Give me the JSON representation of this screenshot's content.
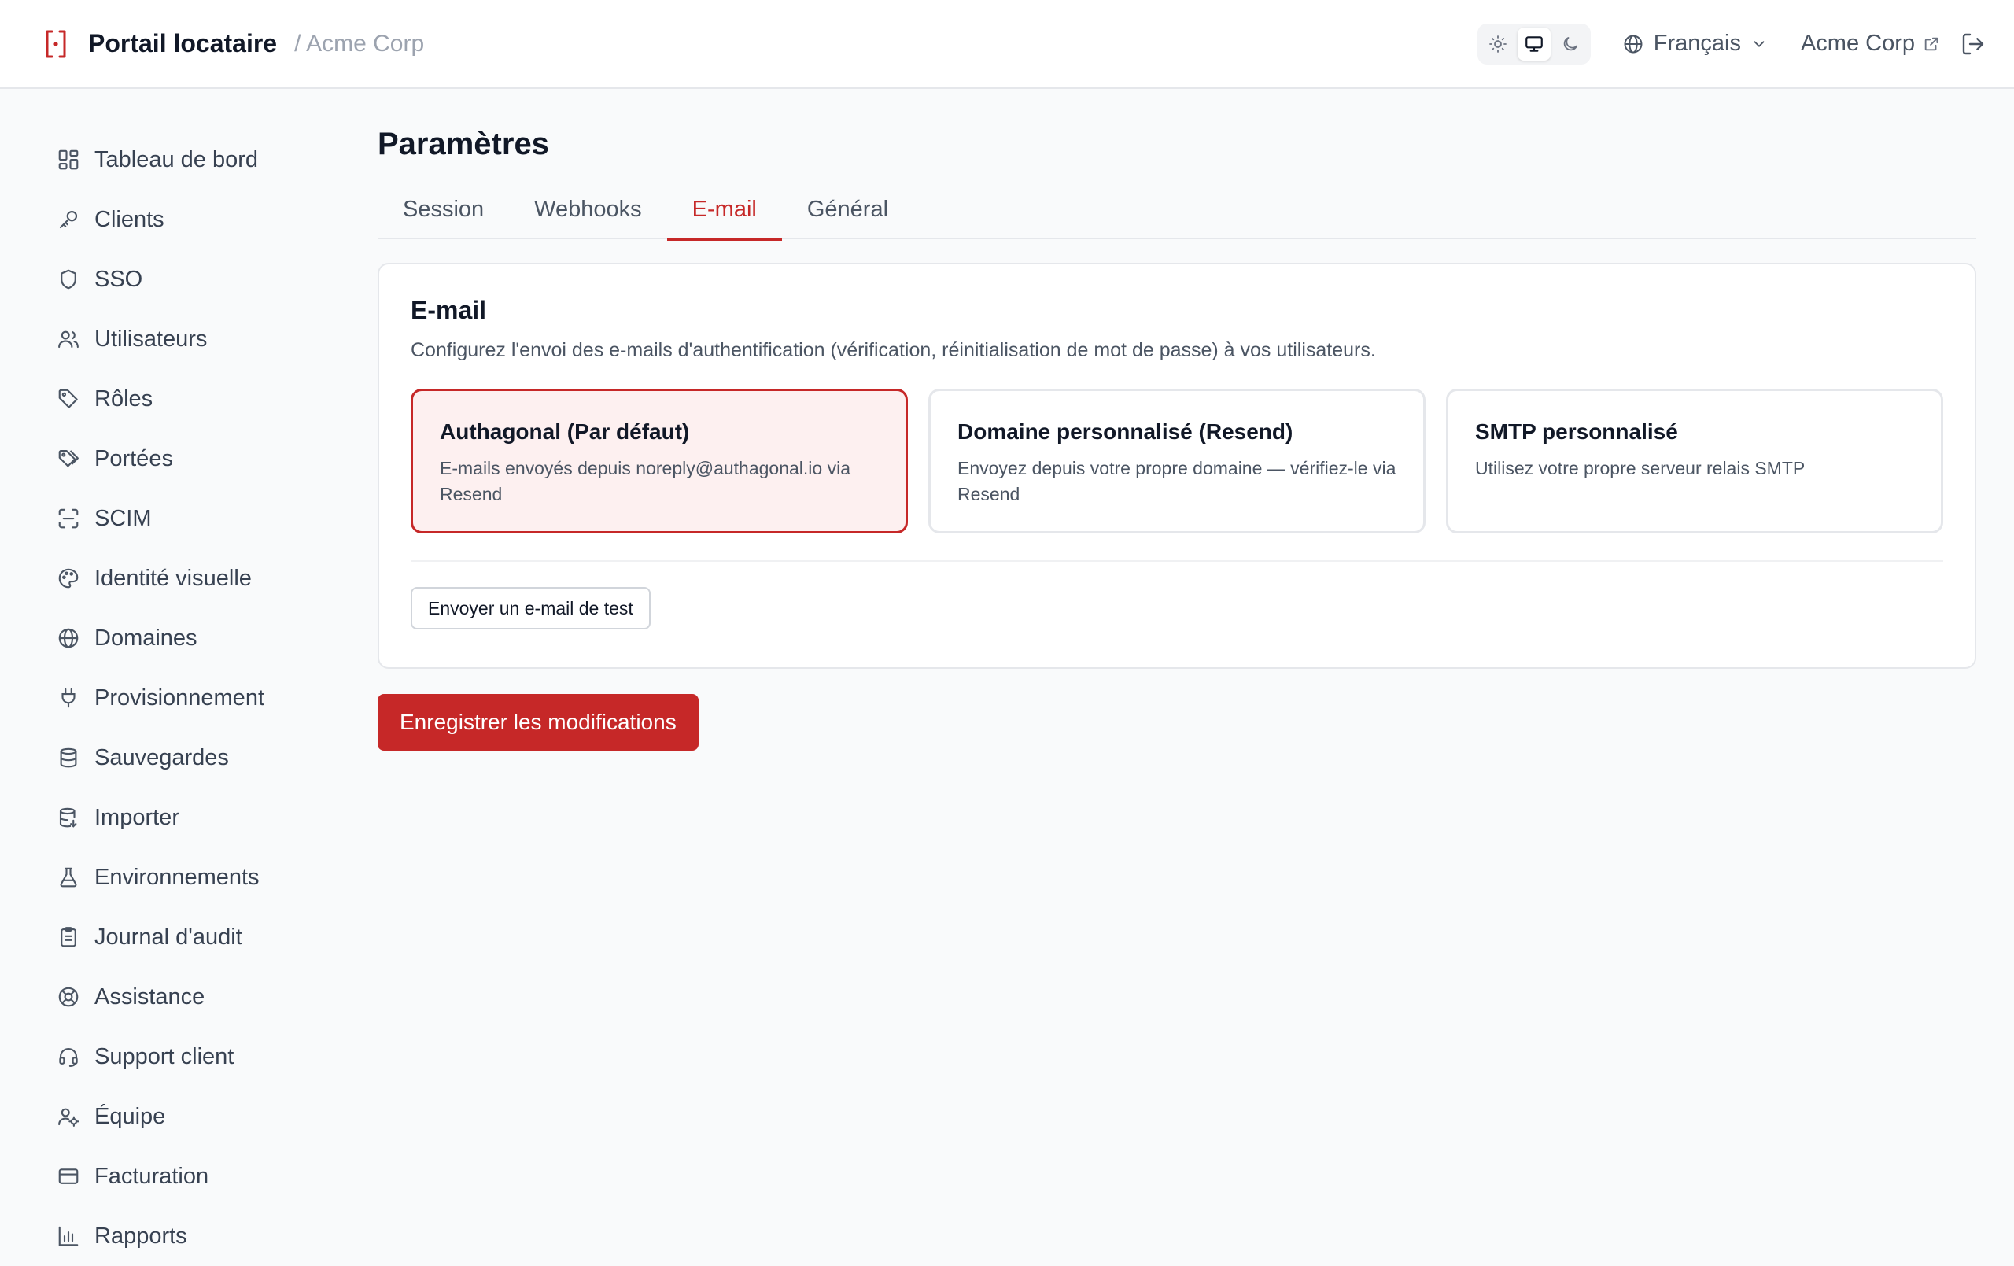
{
  "header": {
    "title": "Portail locataire",
    "tenant_crumb": "/ Acme Corp",
    "language": "Français",
    "tenant_link": "Acme Corp",
    "theme_active": "system"
  },
  "sidebar": {
    "items": [
      {
        "label": "Tableau de bord",
        "icon": "dashboard-icon"
      },
      {
        "label": "Clients",
        "icon": "key-icon"
      },
      {
        "label": "SSO",
        "icon": "shield-icon"
      },
      {
        "label": "Utilisateurs",
        "icon": "users-icon"
      },
      {
        "label": "Rôles",
        "icon": "tag-icon"
      },
      {
        "label": "Portées",
        "icon": "tags-icon"
      },
      {
        "label": "SCIM",
        "icon": "scan-icon"
      },
      {
        "label": "Identité visuelle",
        "icon": "palette-icon"
      },
      {
        "label": "Domaines",
        "icon": "globe-icon"
      },
      {
        "label": "Provisionnement",
        "icon": "plug-icon"
      },
      {
        "label": "Sauvegardes",
        "icon": "database-icon"
      },
      {
        "label": "Importer",
        "icon": "database-import-icon"
      },
      {
        "label": "Environnements",
        "icon": "flask-icon"
      },
      {
        "label": "Journal d'audit",
        "icon": "clipboard-icon"
      },
      {
        "label": "Assistance",
        "icon": "lifebuoy-icon"
      },
      {
        "label": "Support client",
        "icon": "headset-icon"
      },
      {
        "label": "Équipe",
        "icon": "user-cog-icon"
      },
      {
        "label": "Facturation",
        "icon": "credit-card-icon"
      },
      {
        "label": "Rapports",
        "icon": "bar-chart-icon"
      }
    ]
  },
  "main": {
    "title": "Paramètres",
    "tabs": [
      {
        "label": "Session",
        "active": false
      },
      {
        "label": "Webhooks",
        "active": false
      },
      {
        "label": "E-mail",
        "active": true
      },
      {
        "label": "Général",
        "active": false
      }
    ],
    "card": {
      "title": "E-mail",
      "description": "Configurez l'envoi des e-mails d'authentification (vérification, réinitialisation de mot de passe) à vos utilisateurs.",
      "options": [
        {
          "title": "Authagonal (Par défaut)",
          "description": "E-mails envoyés depuis noreply@authagonal.io via Resend",
          "selected": true
        },
        {
          "title": "Domaine personnalisé (Resend)",
          "description": "Envoyez depuis votre propre domaine — vérifiez-le via Resend",
          "selected": false
        },
        {
          "title": "SMTP personnalisé",
          "description": "Utilisez votre propre serveur relais SMTP",
          "selected": false
        }
      ],
      "test_button": "Envoyer un e-mail de test"
    },
    "save_button": "Enregistrer les modifications"
  },
  "colors": {
    "accent": "#c62828",
    "selected_bg": "#fdf0f0"
  }
}
